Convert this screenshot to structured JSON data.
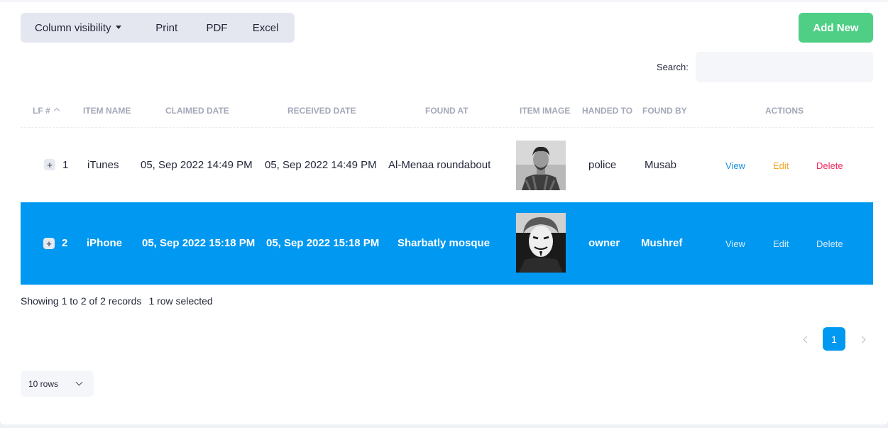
{
  "toolbar": {
    "column_visibility": "Column visibility",
    "print": "Print",
    "pdf": "PDF",
    "excel": "Excel",
    "add_new": "Add New"
  },
  "search": {
    "label": "Search:",
    "value": "",
    "placeholder": ""
  },
  "table": {
    "headers": {
      "lf": "LF #",
      "item_name": "ITEM NAME",
      "claimed_date": "CLAIMED DATE",
      "received_date": "RECEIVED DATE",
      "found_at": "FOUND AT",
      "item_image": "ITEM IMAGE",
      "handed_to": "HANDED TO",
      "found_by": "FOUND BY",
      "actions": "ACTIONS"
    },
    "rows": [
      {
        "expand": "+",
        "lf": "1",
        "item_name": "iTunes",
        "claimed_date": "05, Sep 2022 14:49 PM",
        "received_date": "05, Sep 2022 14:49 PM",
        "found_at": "Al-Menaa roundabout",
        "handed_to": "police",
        "found_by": "Musab",
        "view": "View",
        "edit": "Edit",
        "delete": "Delete",
        "selected": false
      },
      {
        "expand": "+",
        "lf": "2",
        "item_name": "iPhone",
        "claimed_date": "05, Sep 2022 15:18 PM",
        "received_date": "05, Sep 2022 15:18 PM",
        "found_at": "Sharbatly mosque",
        "handed_to": "owner",
        "found_by": "Mushref",
        "view": "View",
        "edit": "Edit",
        "delete": "Delete",
        "selected": true
      }
    ]
  },
  "footer": {
    "showing": "Showing 1 to 2 of 2 records",
    "selected": "1 row selected",
    "current_page": "1",
    "rows_per_page": "10 rows"
  },
  "colors": {
    "selected_row": "#0098f0",
    "add_new": "#4fcf86",
    "view": "#1a8fe0",
    "edit": "#f5a623",
    "delete": "#f0285a"
  }
}
